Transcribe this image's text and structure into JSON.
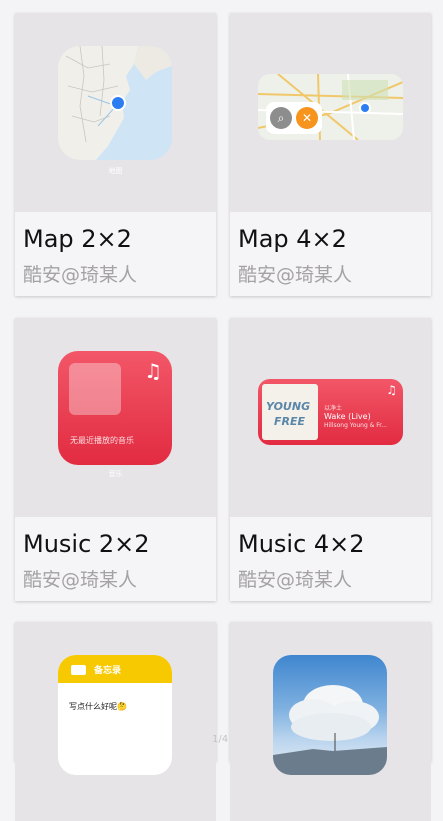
{
  "cards": [
    {
      "title": "Map 2×2",
      "author": "酷安@琦某人",
      "caption": "地图"
    },
    {
      "title": "Map 4×2",
      "author": "酷安@琦某人"
    },
    {
      "title": "Music 2×2",
      "author": "酷安@琦某人",
      "empty_text": "无最近播放的音乐",
      "caption": "音乐"
    },
    {
      "title": "Music 4×2",
      "author": "酷安@琦某人",
      "artist_line": "以净土",
      "song": "Wake (Live)",
      "song_sub": "Hillsong Young & Fr...",
      "album_text_1": "YOUNG",
      "album_text_2": "FREE"
    },
    {
      "header": "备忘录",
      "note_text": "写点什么好呢🤔"
    },
    {}
  ],
  "pager": "1/4",
  "colors": {
    "music_red": "#e22b41",
    "memo_yellow": "#f7c900",
    "map_blue": "#2b7df2",
    "food_orange": "#f7941d"
  }
}
